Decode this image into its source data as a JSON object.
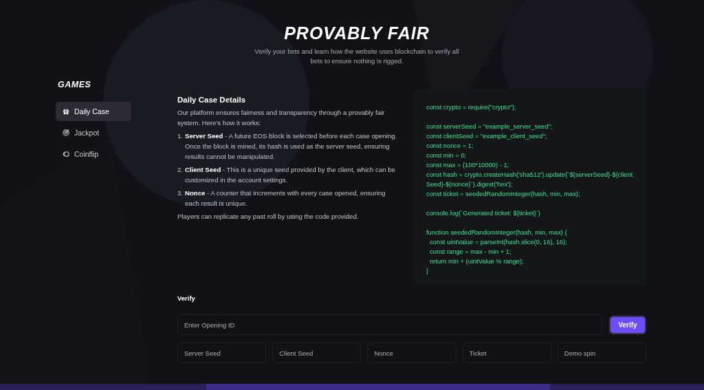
{
  "header": {
    "title": "PROVABLY FAIR",
    "subtitle": "Verify your bets and learn how the website uses blockchain to verify all bets to ensure nothing is rigged."
  },
  "sidebar": {
    "title": "GAMES",
    "items": [
      {
        "label": "Daily Case",
        "kind": "gift",
        "selected": true
      },
      {
        "label": "Jackpot",
        "kind": "target",
        "selected": false
      },
      {
        "label": "Coinflip",
        "kind": "coin",
        "selected": false
      }
    ]
  },
  "details": {
    "title": "Daily Case Details",
    "intro": "Our platform ensures fairness and transparency through a provably fair system. Here's how it works:",
    "steps": [
      {
        "number": "1.",
        "text": "**Server Seed** - A future EOS block is selected before each case opening. Once the block is mined, its hash is used as the server seed, ensuring results cannot be manipulated."
      },
      {
        "number": "2.",
        "text": "**Client Seed** - This is a unique seed provided by the client, which can be customized in the account settings."
      },
      {
        "number": "3.",
        "text": "**Nonce** - A counter that increments with every case opened, ensuring each result is unique."
      }
    ],
    "outro": "Players can replicate any past roll by using the code provided."
  },
  "code": [
    [
      "const crypto = require(\"crypto\");"
    ],
    [
      "const serverSeed = \"example_server_seed\";",
      "const clientSeed = \"example_client_seed\";",
      "const nonce = 1;",
      "const min = 0;",
      "const max = (100*10000) - 1;",
      "const hash = crypto.createHash('sha512').update(`${serverSeed}-${clientSeed}-${nonce}`).digest('hex');",
      "const ticket = seededRandomInteger(hash, min, max);"
    ],
    [
      "console.log(`Generated ticket: ${ticket}`)"
    ],
    [
      "function seededRandomInteger(hash, min, max) {",
      "  const uintValue = parseInt(hash.slice(0, 16), 16);",
      "  const range = max - min + 1;",
      "  return min + (uintValue % range);",
      "}"
    ]
  ],
  "verify": {
    "title": "Verify",
    "input": {
      "placeholder": "Enter Opening ID"
    },
    "button": "Verify",
    "fields": [
      {
        "placeholder": "Server Seed"
      },
      {
        "placeholder": "Client Seed"
      },
      {
        "placeholder": "Nonce"
      },
      {
        "placeholder": "Ticket"
      },
      {
        "placeholder": "Demo spin"
      }
    ]
  }
}
